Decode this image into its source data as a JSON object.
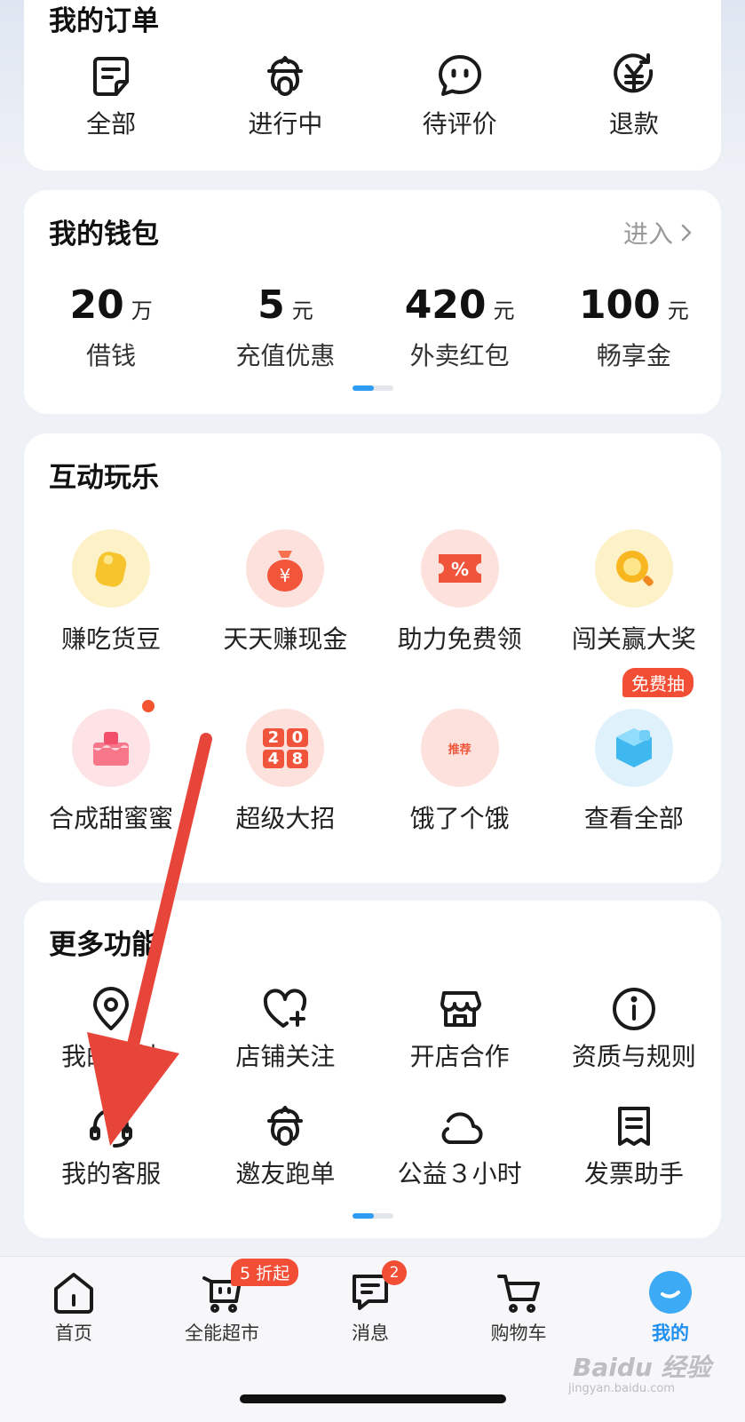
{
  "orders": {
    "title": "我的订单",
    "items": [
      {
        "label": "全部",
        "icon": "order-all-icon"
      },
      {
        "label": "进行中",
        "icon": "rider-icon"
      },
      {
        "label": "待评价",
        "icon": "chat-bubble-icon"
      },
      {
        "label": "退款",
        "icon": "refund-icon"
      }
    ]
  },
  "wallet": {
    "title": "我的钱包",
    "enter": "进入",
    "items": [
      {
        "value": "20",
        "unit": "万",
        "label": "借钱"
      },
      {
        "value": "5",
        "unit": "元",
        "label": "充值优惠"
      },
      {
        "value": "420",
        "unit": "元",
        "label": "外卖红包"
      },
      {
        "value": "100",
        "unit": "元",
        "label": "畅享金"
      }
    ]
  },
  "play": {
    "title": "互动玩乐",
    "items": [
      {
        "label": "赚吃货豆",
        "icon": "bean-icon"
      },
      {
        "label": "天天赚现金",
        "icon": "money-bag-icon"
      },
      {
        "label": "助力免费领",
        "icon": "coupon-icon"
      },
      {
        "label": "闯关赢大奖",
        "icon": "magnifier-coin-icon"
      },
      {
        "label": "合成甜蜜蜜",
        "icon": "cake-icon"
      },
      {
        "label": "超级大招",
        "icon": "game-2048-icon",
        "digits": [
          "2",
          "0",
          "4",
          "8"
        ]
      },
      {
        "label": "饿了个饿",
        "icon": "recommend-icon",
        "badge_text": "推荐"
      },
      {
        "label": "查看全部",
        "icon": "cube-icon"
      }
    ],
    "free_tag": "免费抽"
  },
  "more": {
    "title": "更多功能",
    "items": [
      {
        "label": "我的地址",
        "icon": "location-icon"
      },
      {
        "label": "店铺关注",
        "icon": "heart-plus-icon"
      },
      {
        "label": "开店合作",
        "icon": "store-icon"
      },
      {
        "label": "资质与规则",
        "icon": "info-icon"
      },
      {
        "label": "我的客服",
        "icon": "headset-icon"
      },
      {
        "label": "邀友跑单",
        "icon": "rider-icon"
      },
      {
        "label": "公益３小时",
        "icon": "cloud-icon"
      },
      {
        "label": "发票助手",
        "icon": "receipt-icon"
      }
    ]
  },
  "nav": {
    "items": [
      {
        "label": "首页",
        "icon": "home-icon"
      },
      {
        "label": "全能超市",
        "icon": "supermarket-icon",
        "badge": "5 折起"
      },
      {
        "label": "消息",
        "icon": "message-icon",
        "badge": "2"
      },
      {
        "label": "购物车",
        "icon": "cart-icon"
      },
      {
        "label": "我的",
        "icon": "profile-icon",
        "active": true
      }
    ]
  },
  "watermark": {
    "brand": "Baidu 经验",
    "url": "jingyan.baidu.com"
  },
  "colors": {
    "accent": "#1f8ff0",
    "annotation_arrow": "#e8453a",
    "badge": "#f24d35"
  }
}
